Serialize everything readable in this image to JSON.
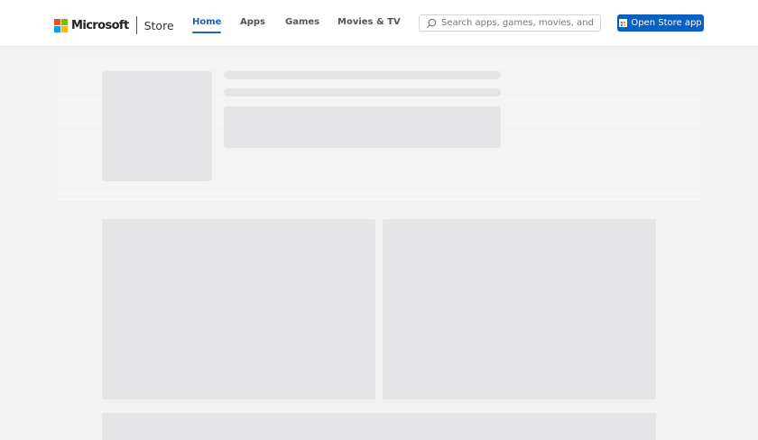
{
  "header": {
    "brand": "Microsoft",
    "product": "Store",
    "nav": [
      {
        "label": "Home",
        "active": true
      },
      {
        "label": "Apps"
      },
      {
        "label": "Games"
      },
      {
        "label": "Movies & TV"
      }
    ],
    "search_placeholder": "Search apps, games, movies, and more",
    "open_app_label": "Open Store app",
    "accent": "#0a5fc0"
  }
}
